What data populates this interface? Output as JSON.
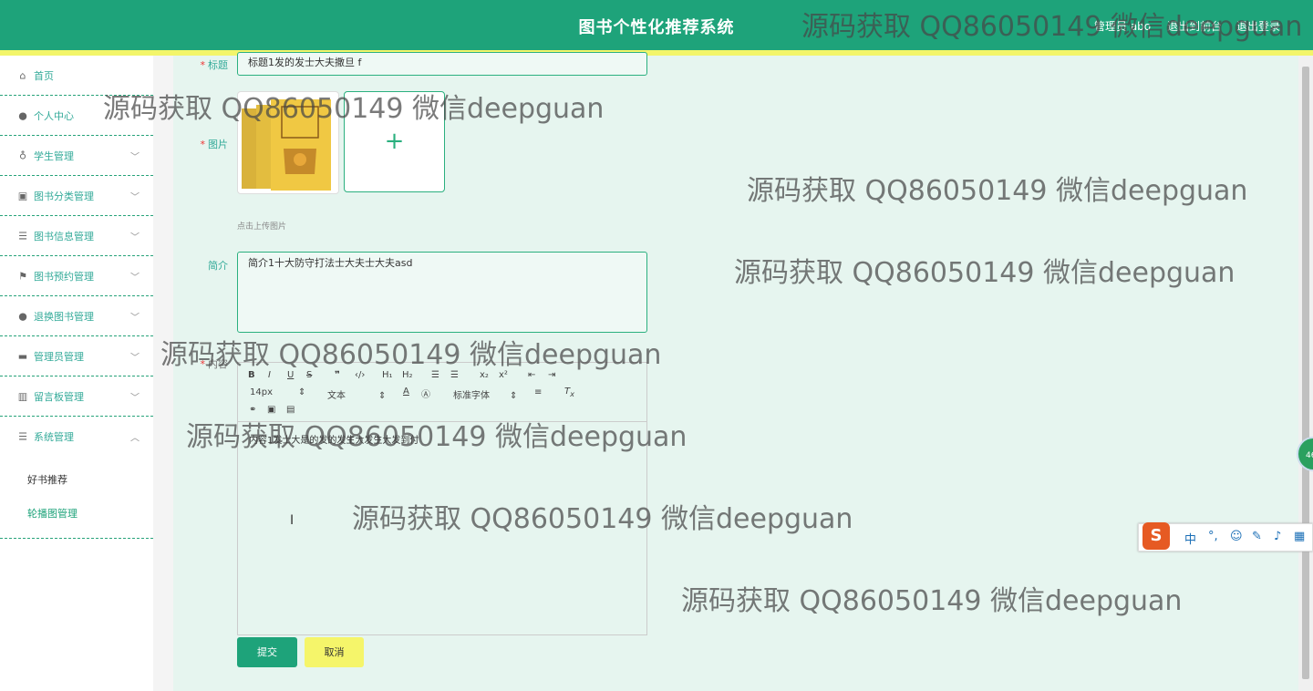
{
  "header": {
    "title": "图书个性化推荐系统",
    "user_name": "管理员 abo",
    "switch_label": "退出到前台",
    "logout_label": "退出登录"
  },
  "sidebar": {
    "items": [
      {
        "label": "首页",
        "icon": "home-icon",
        "chevron": ""
      },
      {
        "label": "个人中心",
        "icon": "user-icon",
        "chevron": ""
      },
      {
        "label": "学生管理",
        "icon": "mic-icon",
        "chevron": "﹀"
      },
      {
        "label": "图书分类管理",
        "icon": "chart-icon",
        "chevron": "﹀"
      },
      {
        "label": "图书信息管理",
        "icon": "list-icon",
        "chevron": "﹀"
      },
      {
        "label": "图书预约管理",
        "icon": "flag-icon",
        "chevron": "﹀"
      },
      {
        "label": "退换图书管理",
        "icon": "user-icon",
        "chevron": "﹀"
      },
      {
        "label": "管理员管理",
        "icon": "monitor-icon",
        "chevron": "﹀"
      },
      {
        "label": "留言板管理",
        "icon": "bar-chart-icon",
        "chevron": "﹀"
      },
      {
        "label": "系统管理",
        "icon": "menu-icon",
        "chevron": "︿"
      }
    ],
    "subitems": [
      "好书推荐",
      "轮播图管理"
    ]
  },
  "form": {
    "title_label": "标题",
    "title_value": "标题1发的发士大夫撒旦 f",
    "image_label": "图片",
    "upload_hint": "点击上传图片",
    "intro_label": "简介",
    "intro_value": "简介1十大防守打法士大夫士大夫asd",
    "content_label": "内容",
    "content_value": "内容1发士大是的发的发生大发生大发到付",
    "font_size": "14px",
    "text_type": "文本",
    "font_family": "标准字体",
    "submit_label": "提交",
    "cancel_label": "取消"
  },
  "ime": {
    "logo": "S",
    "mode": "中"
  },
  "float_ball": "46",
  "watermark_text": "源码获取 QQ86050149 微信deepguan",
  "colors": {
    "primary": "#1ea37a",
    "accent": "#f3f56a",
    "panel": "#e6f5ef"
  }
}
